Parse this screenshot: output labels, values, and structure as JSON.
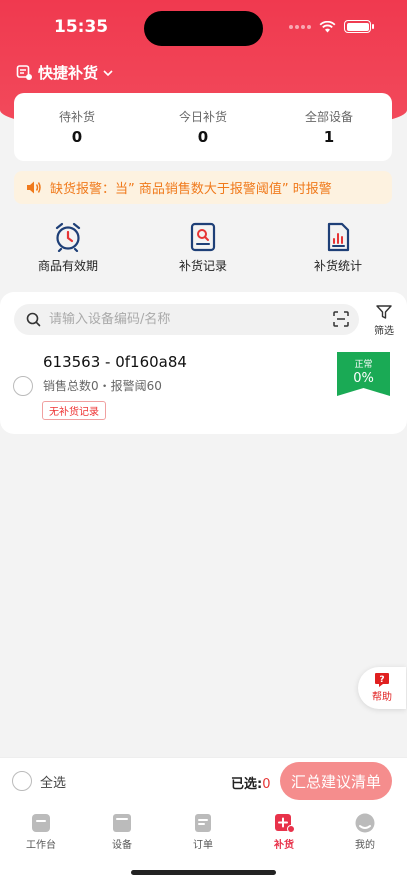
{
  "status_bar": {
    "time": "15:35"
  },
  "header": {
    "title": "快捷补货"
  },
  "stats": [
    {
      "label": "待补货",
      "value": "0"
    },
    {
      "label": "今日补货",
      "value": "0"
    },
    {
      "label": "全部设备",
      "value": "1"
    }
  ],
  "alert": {
    "text": "缺货报警：当” 商品销售数大于报警阈值” 时报警",
    "color": "#f07a1c"
  },
  "shortcuts": [
    {
      "label": "商品有效期",
      "icon": "alarm-clock-icon"
    },
    {
      "label": "补货记录",
      "icon": "search-record-icon"
    },
    {
      "label": "补货统计",
      "icon": "bar-chart-doc-icon"
    }
  ],
  "search": {
    "placeholder": "请输入设备编码/名称",
    "filter_label": "筛选"
  },
  "devices": [
    {
      "title": "613563 - 0f160a84",
      "subtitle": "销售总数0・报警阈60",
      "tag": "无补货记录",
      "status_label": "正常",
      "status_value": "0%",
      "status_color": "#1aaa55"
    }
  ],
  "help": {
    "label": "帮助"
  },
  "bottom": {
    "select_all": "全选",
    "selected_label": "已选:",
    "selected_count": "0",
    "summary_button": "汇总建议清单"
  },
  "tabs": [
    {
      "label": "工作台",
      "icon": "workbench-icon"
    },
    {
      "label": "设备",
      "icon": "device-icon"
    },
    {
      "label": "订单",
      "icon": "order-icon"
    },
    {
      "label": "补货",
      "icon": "restock-icon",
      "active": true
    },
    {
      "label": "我的",
      "icon": "profile-icon"
    }
  ],
  "colors": {
    "accent": "#f0394f",
    "active_tab": "#e8324a",
    "button": "#f58d8d"
  }
}
